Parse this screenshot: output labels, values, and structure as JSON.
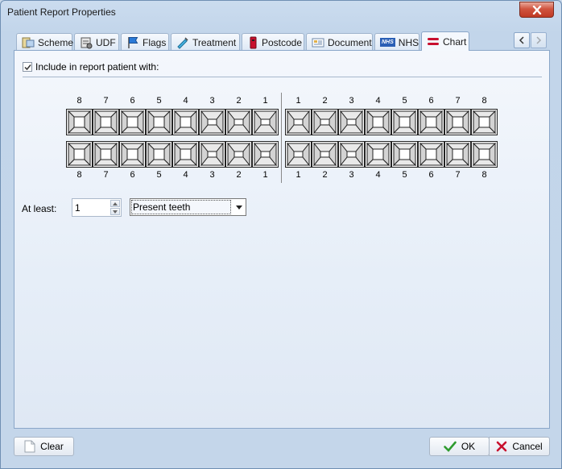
{
  "window": {
    "title": "Patient Report Properties"
  },
  "tabs": [
    {
      "label": "Scheme",
      "icon": "scheme-icon"
    },
    {
      "label": "UDF",
      "icon": "udf-icon"
    },
    {
      "label": "Flags",
      "icon": "flag-icon"
    },
    {
      "label": "Treatment",
      "icon": "treatment-icon"
    },
    {
      "label": "Postcode",
      "icon": "postcode-icon"
    },
    {
      "label": "Document",
      "icon": "document-icon"
    },
    {
      "label": "NHS",
      "icon": "nhs-logo-icon",
      "logo_text": "NHS"
    },
    {
      "label": "Chart",
      "icon": "chart-icon",
      "active": true
    }
  ],
  "chart_tab": {
    "include_label": "Include in report patient with:",
    "include_checked": true,
    "upper_left_numbers": [
      "8",
      "7",
      "6",
      "5",
      "4",
      "3",
      "2",
      "1"
    ],
    "upper_right_numbers": [
      "1",
      "2",
      "3",
      "4",
      "5",
      "6",
      "7",
      "8"
    ],
    "lower_left_numbers": [
      "8",
      "7",
      "6",
      "5",
      "4",
      "3",
      "2",
      "1"
    ],
    "lower_right_numbers": [
      "1",
      "2",
      "3",
      "4",
      "5",
      "6",
      "7",
      "8"
    ],
    "at_least_label": "At least:",
    "at_least_value": "1",
    "teeth_type_selected": "Present teeth"
  },
  "buttons": {
    "clear": "Clear",
    "ok": "OK",
    "cancel": "Cancel"
  },
  "colors": {
    "accent_red": "#c8102e",
    "ok_green": "#2e9b2e",
    "panel_border": "#8aa6c8"
  }
}
